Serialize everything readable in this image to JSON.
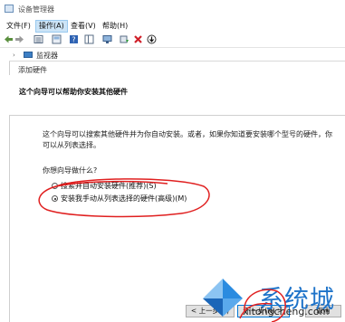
{
  "window": {
    "title": "设备管理器"
  },
  "menu": [
    {
      "label": "文件(F)",
      "active": false
    },
    {
      "label": "操作(A)",
      "active": true
    },
    {
      "label": "查看(V)",
      "active": false
    },
    {
      "label": "帮助(H)",
      "active": false
    }
  ],
  "tree": {
    "expander": "›",
    "node_label": "监视器"
  },
  "wizard": {
    "title": "添加硬件",
    "heading": "这个向导可以帮助你安装其他硬件",
    "description_line1": "这个向导可以搜索其他硬件并为你自动安装。或者，如果你知道要安装哪个型号的硬件，你",
    "description_line2": "可以从列表选择。",
    "question": "你想向导做什么?",
    "options": [
      {
        "label": "搜索并自动安装硬件(推荐)(S)",
        "checked": false
      },
      {
        "label": "安装我手动从列表选择的硬件(高级)(M)",
        "checked": true
      }
    ],
    "buttons": {
      "back": "< 上一步(B)",
      "next": "下一步(N) >",
      "cancel": "取消"
    }
  },
  "watermark": {
    "brand": "系统城",
    "url": "xitongcheng.com"
  },
  "colors": {
    "annotation": "#e02020",
    "watermark_blue": "#1e73c9",
    "menu_active": "#cce4f7"
  }
}
